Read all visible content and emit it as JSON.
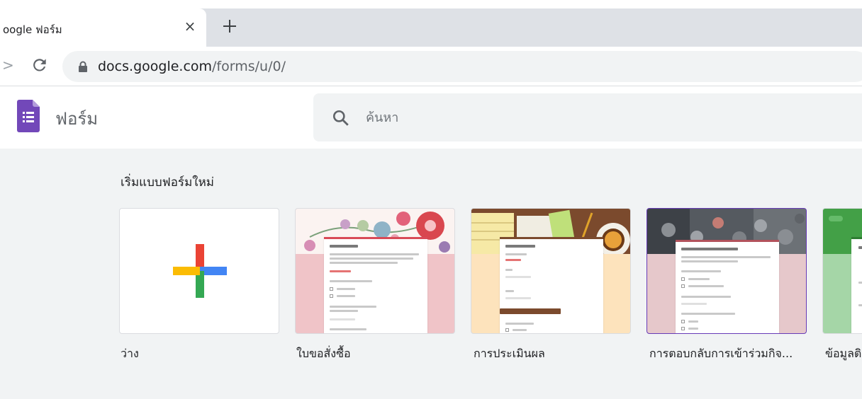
{
  "browser": {
    "tab_title": "oogle ฟอร์ม",
    "tab_close": "×",
    "url_host": "docs.google.com",
    "url_path": "/forms/u/0/"
  },
  "app": {
    "title": "ฟอร์ม",
    "search_placeholder": "ค้นหา",
    "accent_color": "#673ab7"
  },
  "gallery": {
    "heading": "เริ่มแบบฟอร์มใหม่",
    "templates": [
      {
        "label": "ว่าง",
        "icon": "plus-icon"
      },
      {
        "label": "ใบขอสั่งซื้อ",
        "theme_color": "#f0c4c8"
      },
      {
        "label": "การประเมินผล",
        "theme_color": "#fde3bc"
      },
      {
        "label": "การตอบกลับการเข้าร่วมกิจ...",
        "theme_color": "#e6c8cb",
        "selected": true
      },
      {
        "label": "ข้อมูลติ",
        "theme_color": "#a5d6a7"
      }
    ]
  }
}
